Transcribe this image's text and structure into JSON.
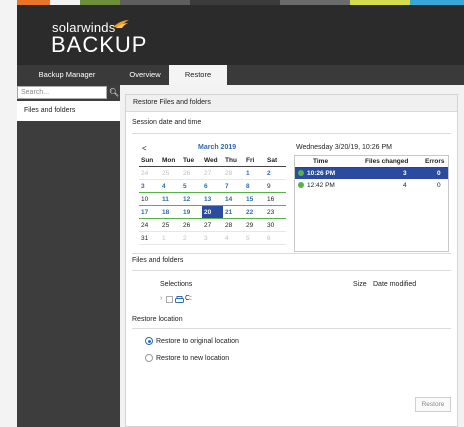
{
  "colors": {
    "top_bar": [
      "#e8742a",
      "#f2f2f2",
      "#6d8e3b",
      "#5e5e5e",
      "#3b3b3b",
      "#6b6b6b",
      "#d5dd4c",
      "#3aa7d8"
    ],
    "accent_blue": "#2a4ba0",
    "green": "#53b548"
  },
  "logo": {
    "line1": "solarwinds",
    "line2": "BACKUP",
    "mark": "solarwinds-flame-icon"
  },
  "nav": {
    "app_title": "Backup Manager",
    "tabs": [
      {
        "label": "Overview"
      },
      {
        "label": "Restore"
      }
    ],
    "active_tab": "Restore"
  },
  "sidebar": {
    "search_placeholder": "Search...",
    "search_icon": "search-icon",
    "items": [
      {
        "label": "Files and folders"
      }
    ]
  },
  "panel": {
    "title": "Restore Files and folders",
    "session_section": "Session date and time",
    "calendar": {
      "prev": "<",
      "month_label": "March 2019",
      "weekdays": [
        "Sun",
        "Mon",
        "Tue",
        "Wed",
        "Thu",
        "Fri",
        "Sat"
      ],
      "weeks": [
        [
          "24",
          "25",
          "26",
          "27",
          "28",
          "1",
          "2"
        ],
        [
          "3",
          "4",
          "5",
          "6",
          "7",
          "8",
          "9"
        ],
        [
          "10",
          "11",
          "12",
          "13",
          "14",
          "15",
          "16"
        ],
        [
          "17",
          "18",
          "19",
          "20",
          "21",
          "22",
          "23"
        ],
        [
          "24",
          "25",
          "26",
          "27",
          "28",
          "29",
          "30"
        ],
        [
          "31",
          "1",
          "2",
          "3",
          "4",
          "5",
          "6"
        ]
      ],
      "selected_day": "20"
    },
    "session_header": "Wednesday 3/20/19, 10:26 PM",
    "session_columns": [
      "Time",
      "Files changed",
      "Errors"
    ],
    "sessions": [
      {
        "time": "10:26 PM",
        "files_changed": "3",
        "errors": "0",
        "selected": true
      },
      {
        "time": "12:42 PM",
        "files_changed": "4",
        "errors": "0",
        "selected": false
      }
    ],
    "files_section": "Files and folders",
    "files_columns": [
      "Selections",
      "Size",
      "Date modified"
    ],
    "tree_item": "C:",
    "restore_location_section": "Restore location",
    "options": [
      {
        "label": "Restore to original location",
        "checked": true
      },
      {
        "label": "Restore to new location",
        "checked": false
      }
    ],
    "restore_button": "Restore"
  }
}
